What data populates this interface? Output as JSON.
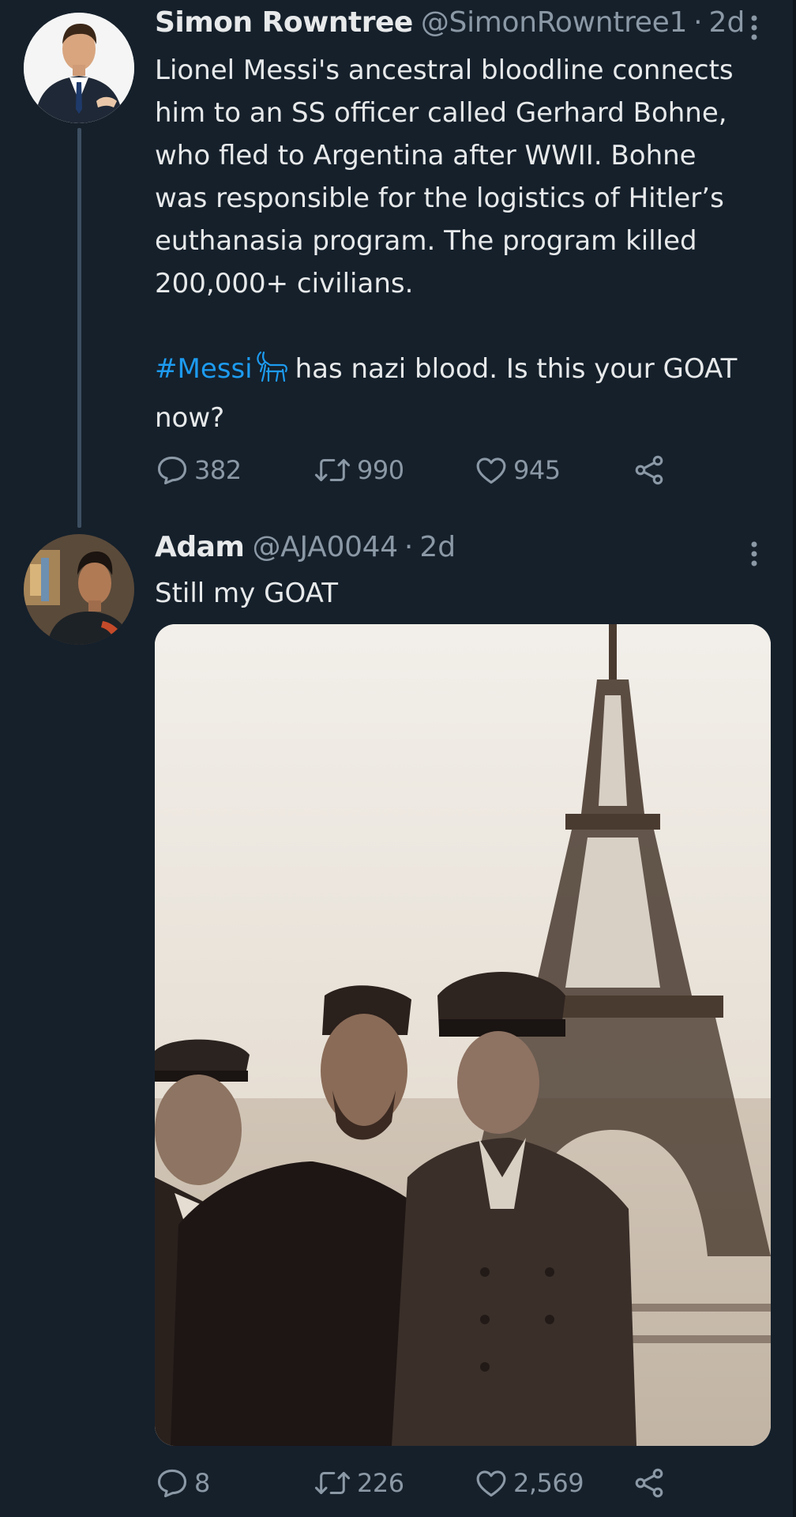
{
  "tweets": [
    {
      "author_name": "Simon Rowntree",
      "handle": "@SimonRowntree1",
      "separator": "·",
      "time": "2d",
      "text_lines": [
        "Lionel Messi's ancestral bloodline connects",
        "him to an SS officer called Gerhard Bohne,",
        "who fled to Argentina after WWII. Bohne",
        "was responsible for the logistics of Hitler’s",
        "euthanasia program. The program killed",
        "200,000+ civilians."
      ],
      "hashtag": "#Messi",
      "emoji_icon": "goat-icon",
      "text_after_hashtag": "has nazi blood. Is this your GOAT",
      "text_last_line": "now?",
      "replies": "382",
      "retweets": "990",
      "likes": "945"
    },
    {
      "author_name": "Adam",
      "handle": "@AJA0044",
      "separator": "·",
      "time": "2d",
      "text": "Still my GOAT",
      "media_icon": "photo",
      "replies": "8",
      "retweets": "226",
      "likes": "2,569"
    }
  ],
  "colors": {
    "background": "#15202b",
    "text": "#e7e9ea",
    "secondary": "#8b98a5",
    "link": "#1d9bf0",
    "thread_line": "#3d4f61"
  },
  "icons": [
    "reply-icon",
    "retweet-icon",
    "like-icon",
    "share-icon",
    "more-icon"
  ]
}
